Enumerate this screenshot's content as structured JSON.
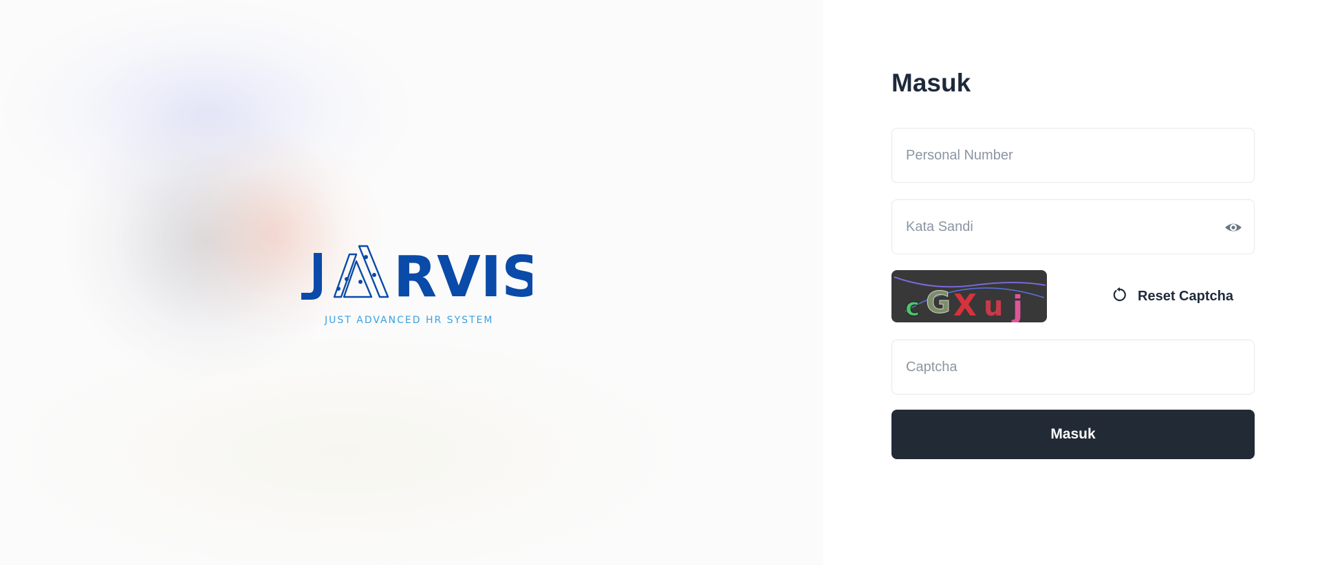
{
  "brand": {
    "name": "JARVIS",
    "tagline": "JUST ADVANCED HR SYSTEM",
    "color_primary": "#0a4aa8",
    "color_tagline": "#3aa0e0"
  },
  "login": {
    "title": "Masuk",
    "personal_number": {
      "placeholder": "Personal Number",
      "value": ""
    },
    "password": {
      "placeholder": "Kata Sandi",
      "value": "",
      "toggle_icon": "eye-icon"
    },
    "captcha_image_text": "cGXuj",
    "reset_captcha_label": "Reset Captcha",
    "reset_icon": "refresh-icon",
    "captcha": {
      "placeholder": "Captcha",
      "value": ""
    },
    "submit_label": "Masuk"
  },
  "colors": {
    "title": "#1e2a3b",
    "button_bg": "#222a36",
    "border": "#e5e8ec"
  }
}
